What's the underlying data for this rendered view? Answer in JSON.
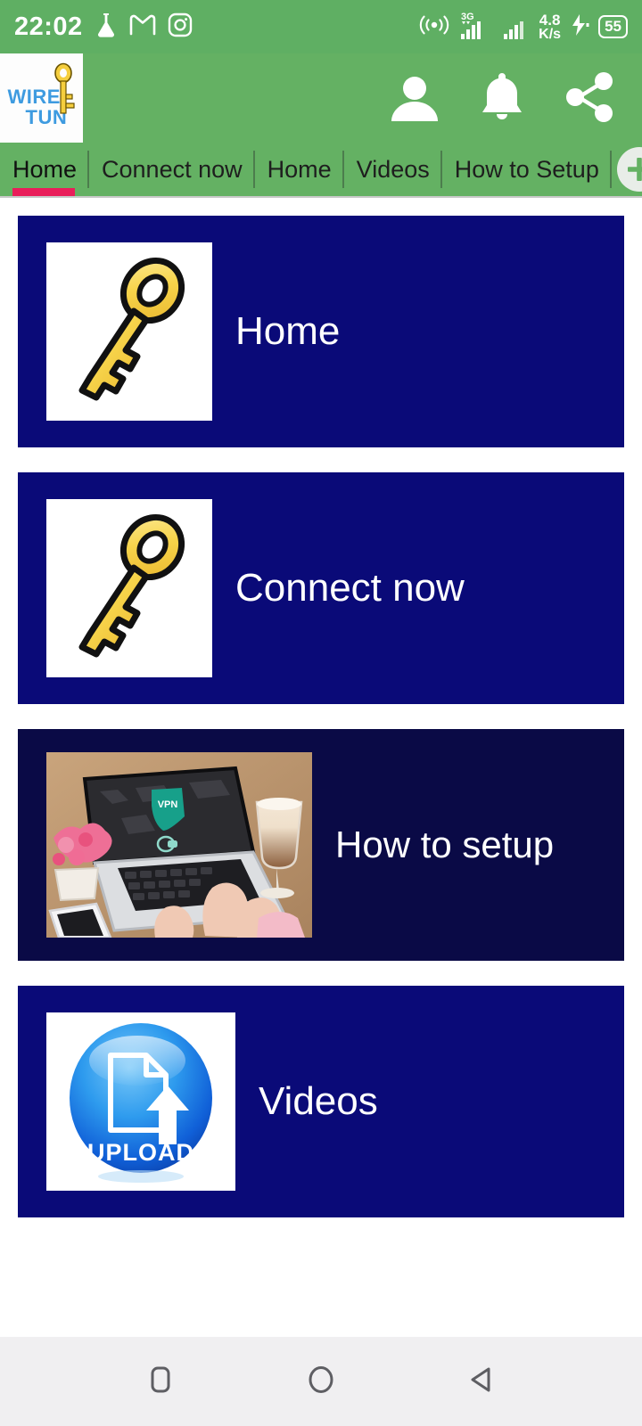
{
  "status_bar": {
    "time": "22:02",
    "icons_left": [
      "flask-icon",
      "gmail-icon",
      "instagram-icon"
    ],
    "icons_right": [
      "hotspot-icon",
      "signal-3g-icon",
      "signal-icon"
    ],
    "net_speed_value": "4.8",
    "net_speed_unit": "K/s",
    "charging_icon": "charging-bolt-icon",
    "battery_level": "55"
  },
  "app_bar": {
    "logo_line1": "WIRE",
    "logo_line2": "TUN",
    "logo_icon": "key-icon",
    "actions": [
      {
        "name": "profile-icon",
        "label": "Profile"
      },
      {
        "name": "notifications-icon",
        "label": "Notifications"
      },
      {
        "name": "share-icon",
        "label": "Share"
      }
    ]
  },
  "tabs": {
    "items": [
      {
        "label": "Home",
        "active": true
      },
      {
        "label": "Connect now",
        "active": false
      },
      {
        "label": "Home",
        "active": false
      },
      {
        "label": "Videos",
        "active": false
      },
      {
        "label": "How to Setup",
        "active": false
      }
    ],
    "add_button_icon": "plus-icon",
    "active_indicator_color": "#E91E5A"
  },
  "cards": [
    {
      "label": "Home",
      "thumb": "gold-key-image",
      "bg": "#0A0A78"
    },
    {
      "label": "Connect now",
      "thumb": "gold-key-image",
      "bg": "#0A0A78"
    },
    {
      "label": "How to setup",
      "thumb": "vpn-laptop-photo",
      "bg": "#0A0A46"
    },
    {
      "label": "Videos",
      "thumb": "upload-sphere-image",
      "bg": "#0A0A78"
    }
  ],
  "thumbnails": {
    "vpn_shield_text": "VPN",
    "upload_text": "UPLOAD"
  },
  "nav_bar": {
    "buttons": [
      {
        "name": "recents-button",
        "icon": "square-icon"
      },
      {
        "name": "home-button",
        "icon": "circle-icon"
      },
      {
        "name": "back-button",
        "icon": "triangle-left-icon"
      }
    ]
  },
  "colors": {
    "status_bar_green": "#5FAF63",
    "app_bar_green": "#64B163",
    "card_navy": "#0A0A78",
    "card_navy_dark": "#0A0A46",
    "accent_pink": "#E91E5A",
    "logo_blue": "#3E9BE0",
    "key_gold": "#F5CE3E"
  }
}
